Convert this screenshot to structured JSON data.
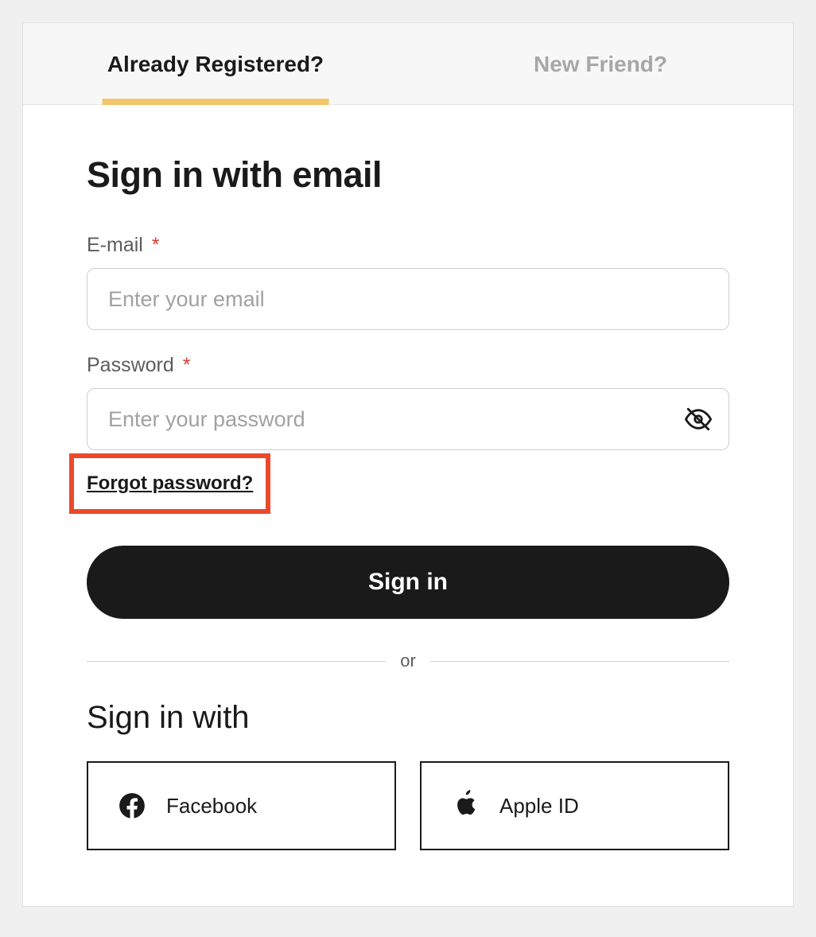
{
  "tabs": {
    "registered": "Already Registered?",
    "new": "New Friend?"
  },
  "title": "Sign in with email",
  "email": {
    "label": "E-mail",
    "placeholder": "Enter your email"
  },
  "password": {
    "label": "Password",
    "placeholder": "Enter your password"
  },
  "required_mark": "*",
  "forgot": "Forgot password?",
  "signin_button": "Sign in",
  "divider": "or",
  "signin_with_title": "Sign in with",
  "social": {
    "facebook": "Facebook",
    "apple": "Apple ID"
  }
}
